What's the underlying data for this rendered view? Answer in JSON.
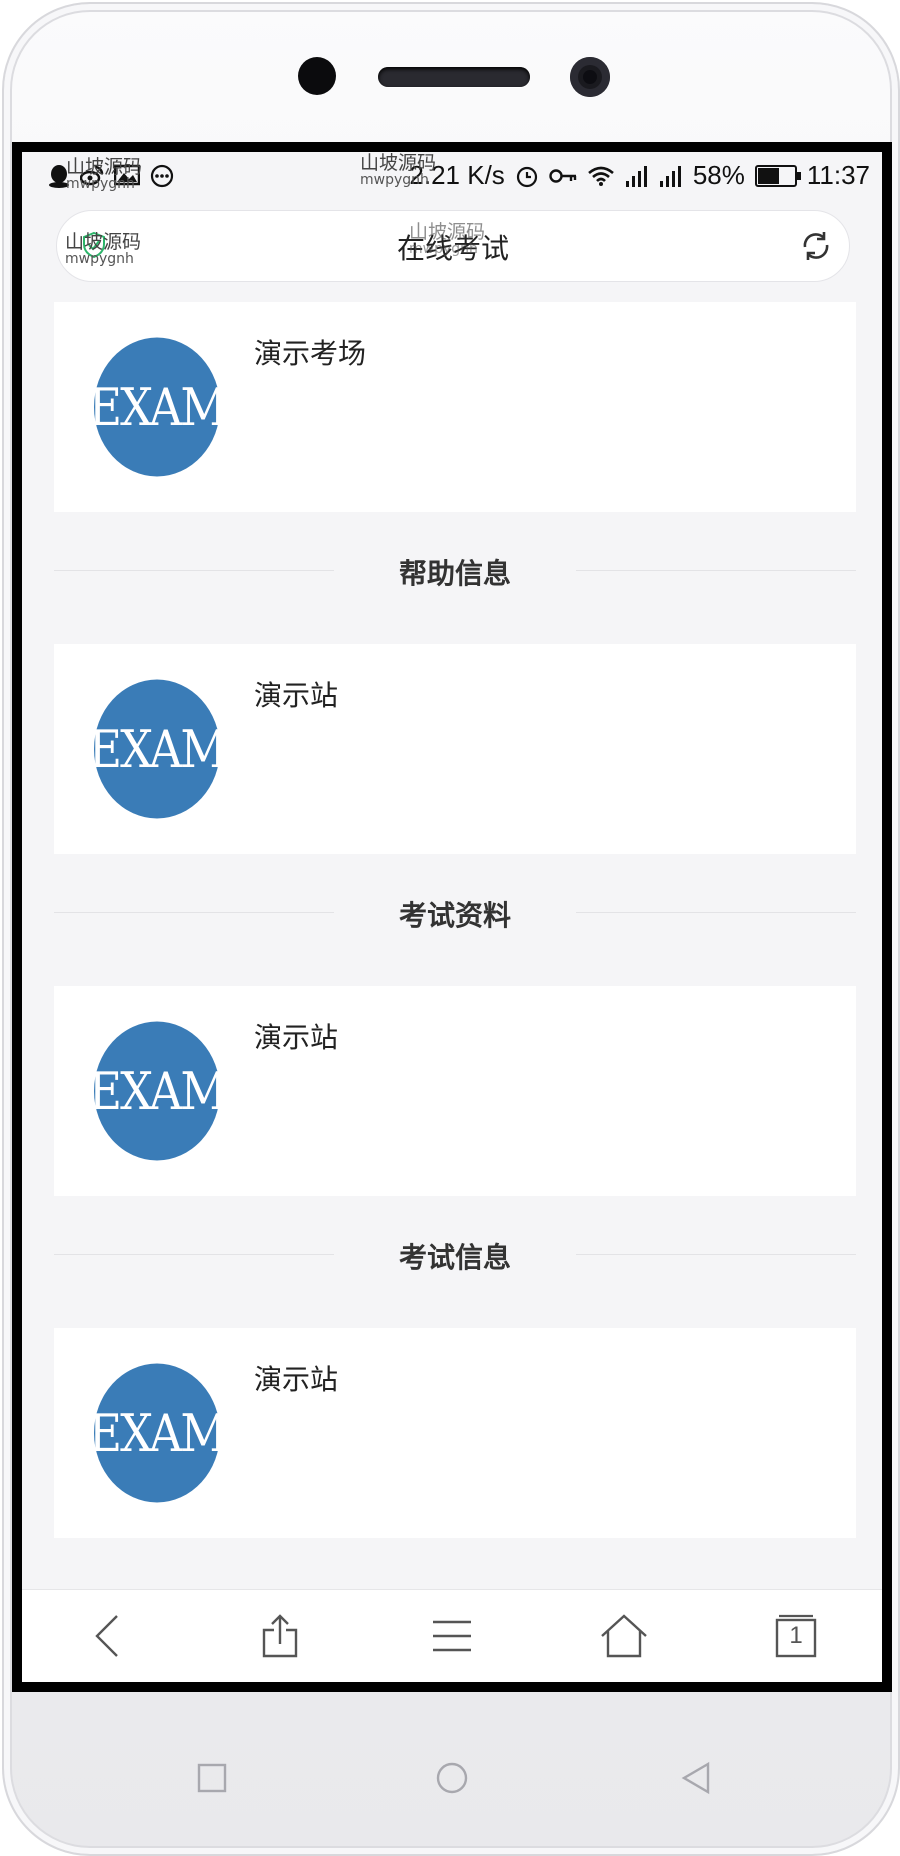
{
  "status_bar": {
    "speed": "2.21 K/s",
    "battery": "58%",
    "battery_level": 0.58,
    "time": "11:37"
  },
  "watermarks": [
    {
      "title": "山坡源码",
      "sub": "mwpygnh"
    },
    {
      "title": "山坡源码",
      "sub": "mwpygnh"
    },
    {
      "title": "山坡源码",
      "sub": "mwpygnh"
    },
    {
      "title": "山坡源码",
      "sub": "mwpygnh"
    }
  ],
  "browser": {
    "page_title": "在线考试"
  },
  "cards": [
    {
      "logo": "EXAM",
      "name": "演示考场"
    },
    {
      "logo": "EXAM",
      "name": "演示站"
    },
    {
      "logo": "EXAM",
      "name": "演示站"
    },
    {
      "logo": "EXAM",
      "name": "演示站"
    }
  ],
  "sections": [
    {
      "label": "帮助信息"
    },
    {
      "label": "考试资料"
    },
    {
      "label": "考试信息"
    }
  ],
  "navbar": {
    "tab_count": "1"
  },
  "icons": {
    "status_left": [
      "qq-icon",
      "weibo-icon",
      "image-icon",
      "more-icon"
    ],
    "status_right": [
      "alarm-icon",
      "key-icon",
      "wifi-icon",
      "signal-icon",
      "signal-icon",
      "battery-icon"
    ],
    "browser": [
      "shield-icon",
      "refresh-icon"
    ],
    "nav": [
      "back-icon",
      "share-icon",
      "menu-icon",
      "home-icon",
      "tabs-icon"
    ],
    "hardware": [
      "recent-apps-icon",
      "home-circle-icon",
      "back-triangle-icon"
    ]
  },
  "colors": {
    "exam_logo": "#3a7cb7",
    "page_background": "#f5f5f7"
  }
}
